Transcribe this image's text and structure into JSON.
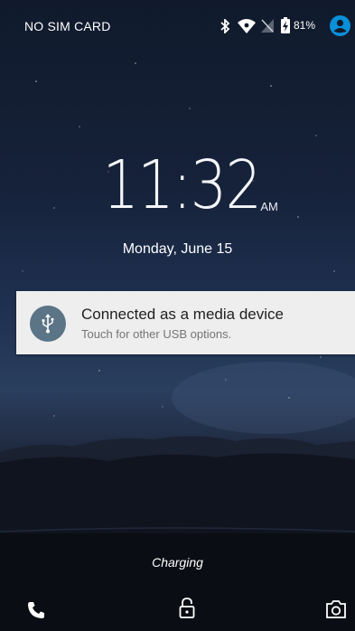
{
  "status_bar": {
    "carrier": "NO SIM CARD",
    "battery_percent": "81%",
    "icons": [
      "bluetooth-icon",
      "wifi-icon",
      "no-sim-signal-icon",
      "battery-charging-icon",
      "user-avatar-icon"
    ],
    "accent_color": "#0a8fd8"
  },
  "clock": {
    "time": "11:32",
    "ampm": "AM",
    "date": "Monday, June 15"
  },
  "notification": {
    "title": "Connected as a media device",
    "text": "Touch for other USB options.",
    "icon": "usb-icon",
    "icon_bg": "#5b7486"
  },
  "lockscreen": {
    "charging_label": "Charging",
    "shortcuts": [
      "phone-icon",
      "lock-icon",
      "camera-icon"
    ]
  }
}
